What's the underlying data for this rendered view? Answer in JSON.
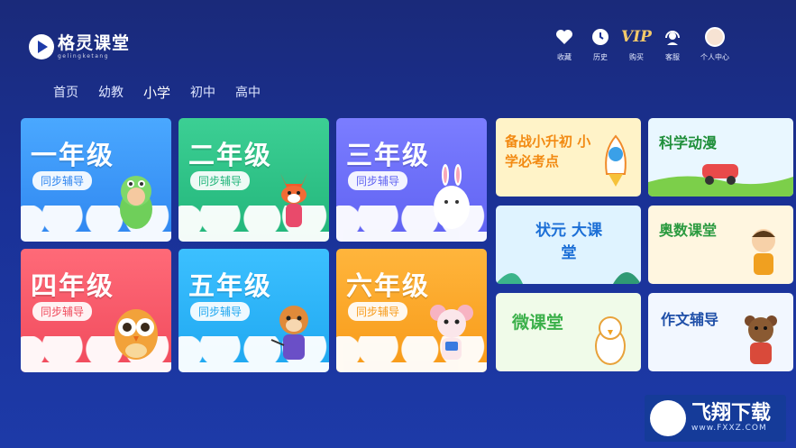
{
  "header": {
    "logo_name": "格灵课堂",
    "logo_sub": "gelingketang",
    "actions": [
      {
        "label": "收藏",
        "icon": "heart-icon"
      },
      {
        "label": "历史",
        "icon": "clock-icon"
      },
      {
        "label": "购买",
        "icon": "vip-icon",
        "badge": "VIP"
      },
      {
        "label": "客服",
        "icon": "headset-icon"
      },
      {
        "label": "个人中心",
        "icon": "avatar-icon"
      }
    ]
  },
  "nav": {
    "items": [
      "首页",
      "幼教",
      "小学",
      "初中",
      "高中"
    ],
    "active": "小学"
  },
  "grades": [
    {
      "title": "一年级",
      "subtitle": "同步辅导",
      "color_top": "#4aa8ff",
      "color_bottom": "#2f86f0",
      "pill_color": "#2f86f0"
    },
    {
      "title": "二年级",
      "subtitle": "同步辅导",
      "color_top": "#3ccf94",
      "color_bottom": "#22b57a",
      "pill_color": "#22b57a"
    },
    {
      "title": "三年级",
      "subtitle": "同步辅导",
      "color_top": "#7b7dff",
      "color_bottom": "#5f62f2",
      "pill_color": "#5f62f2"
    },
    {
      "title": "四年级",
      "subtitle": "同步辅导",
      "color_top": "#ff6a78",
      "color_bottom": "#f04a5c",
      "pill_color": "#f04a5c"
    },
    {
      "title": "五年级",
      "subtitle": "同步辅导",
      "color_top": "#3cc0ff",
      "color_bottom": "#1ea7f0",
      "pill_color": "#1ea7f0"
    },
    {
      "title": "六年级",
      "subtitle": "同步辅导",
      "color_top": "#ffb53c",
      "color_bottom": "#f79a18",
      "pill_color": "#f79a18"
    }
  ],
  "features": [
    {
      "title": "备战小升初 小学必考点",
      "bg": "#fff3c8",
      "color": "#f28a12"
    },
    {
      "title": "科学动漫",
      "bg": "#e9f7ff",
      "color": "#1f8f3a"
    },
    {
      "title": "状元 大课堂",
      "bg": "#dff3ff",
      "color": "#1c6fd6"
    },
    {
      "title": "奥数课堂",
      "bg": "#fff6e0",
      "color": "#2a9a3f"
    },
    {
      "title": "微课堂",
      "bg": "#f0fbe9",
      "color": "#3bb04a"
    },
    {
      "title": "作文辅导",
      "bg": "#f2f7ff",
      "color": "#1f4fa8"
    }
  ],
  "watermark": {
    "text": "飞翔下载",
    "url": "www.FXXZ.COM"
  }
}
